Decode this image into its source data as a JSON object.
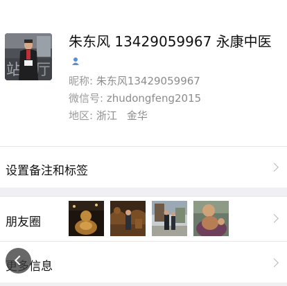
{
  "profile": {
    "name": "朱东风 13429059967 永康中医",
    "nickname_label": "昵称:",
    "nickname": "朱东风13429059967",
    "wechat_id_label": "微信号:",
    "wechat_id": "zhudongfeng2015",
    "region_label": "地区:",
    "province": "浙江",
    "city": "金华",
    "gender_icon": "male-icon",
    "gender_color": "#5b8ed8"
  },
  "menu": {
    "remarks_label": "设置备注和标签",
    "moments_label": "朋友圈",
    "more_info_label": "更多信息"
  },
  "colors": {
    "text": "#111111",
    "secondary": "#8c8c8c",
    "divider": "#e6e6e6",
    "section_gap": "#efeff4"
  }
}
